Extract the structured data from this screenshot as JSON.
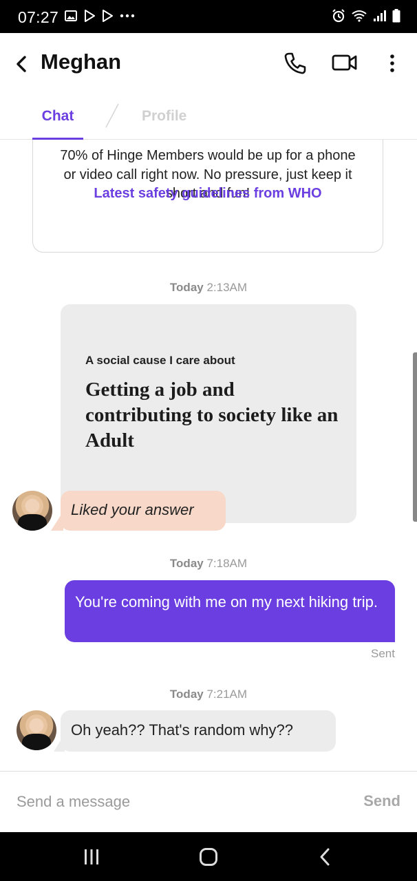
{
  "status_bar": {
    "time": "07:27",
    "left_icons": [
      "image-icon",
      "play-store-icon",
      "play-store-icon",
      "more-dots-icon"
    ],
    "right_icons": [
      "alarm-icon",
      "wifi-icon",
      "signal-icon",
      "battery-icon"
    ]
  },
  "header": {
    "title": "Meghan",
    "icons": [
      "back-icon",
      "phone-icon",
      "video-call-icon",
      "more-icon"
    ]
  },
  "tabs": [
    {
      "label": "Chat",
      "active": true
    },
    {
      "label": "Profile",
      "active": false
    }
  ],
  "info_card": {
    "text": "70% of Hinge Members would be up for a phone or video call right now. No pressure, just keep it short and fun!",
    "link": "Latest safety guidelines from WHO"
  },
  "conversation": {
    "ts1": {
      "day": "Today",
      "time": "2:13AM"
    },
    "prompt": {
      "question": "A social cause I care about",
      "answer": "Getting a job and contributing to society like an Adult"
    },
    "liked": "Liked your answer",
    "ts2": {
      "day": "Today",
      "time": "7:18AM"
    },
    "sent_message": "You're coming with me on my next hiking trip.",
    "sent_status": "Sent",
    "ts3": {
      "day": "Today",
      "time": "7:21AM"
    },
    "received_message": "Oh yeah?? That's random why??"
  },
  "composer": {
    "placeholder": "Send a message",
    "send_label": "Send"
  },
  "colors": {
    "accent": "#6a3ee0",
    "liked_bubble": "#f8d8c8",
    "received_bubble": "#ececec"
  }
}
